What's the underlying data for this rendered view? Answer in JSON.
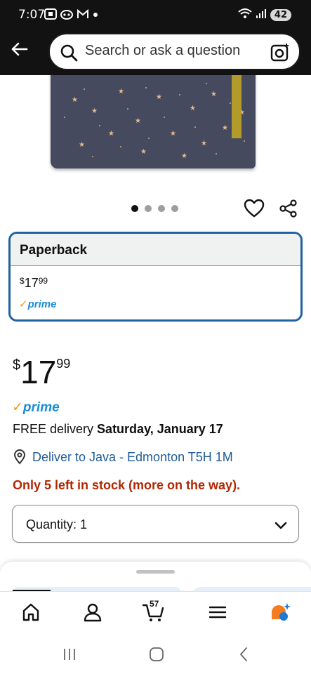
{
  "status_bar": {
    "time": "7:07",
    "left_icons": [
      "screenshot-icon",
      "raccoon-icon",
      "gmail-icon",
      "dot"
    ],
    "battery": "42"
  },
  "header": {
    "search_placeholder": "Search or ask a question"
  },
  "gallery": {
    "image_count": 4,
    "active_index": 0
  },
  "format": {
    "title": "Paperback",
    "price_currency": "$",
    "price_whole": "17",
    "price_fraction": "99",
    "prime_label": "prime"
  },
  "buybox": {
    "price_currency": "$",
    "price_whole": "17",
    "price_fraction": "99",
    "prime_label": "prime",
    "delivery_prefix": "FREE delivery ",
    "delivery_date": "Saturday, January 17",
    "location": "Deliver to Java - Edmonton T5H 1M",
    "stock": "Only 5 left in stock (more on the way).",
    "quantity": "Quantity: 1"
  },
  "bottom_nav": {
    "cart_count": "57"
  },
  "colors": {
    "header_bg": "#121212",
    "format_border": "#2162a1",
    "link_blue": "#1f5c99",
    "stock_red": "#b12704",
    "prime_blue": "#1a8cd8",
    "prime_orange": "#f29b14"
  }
}
